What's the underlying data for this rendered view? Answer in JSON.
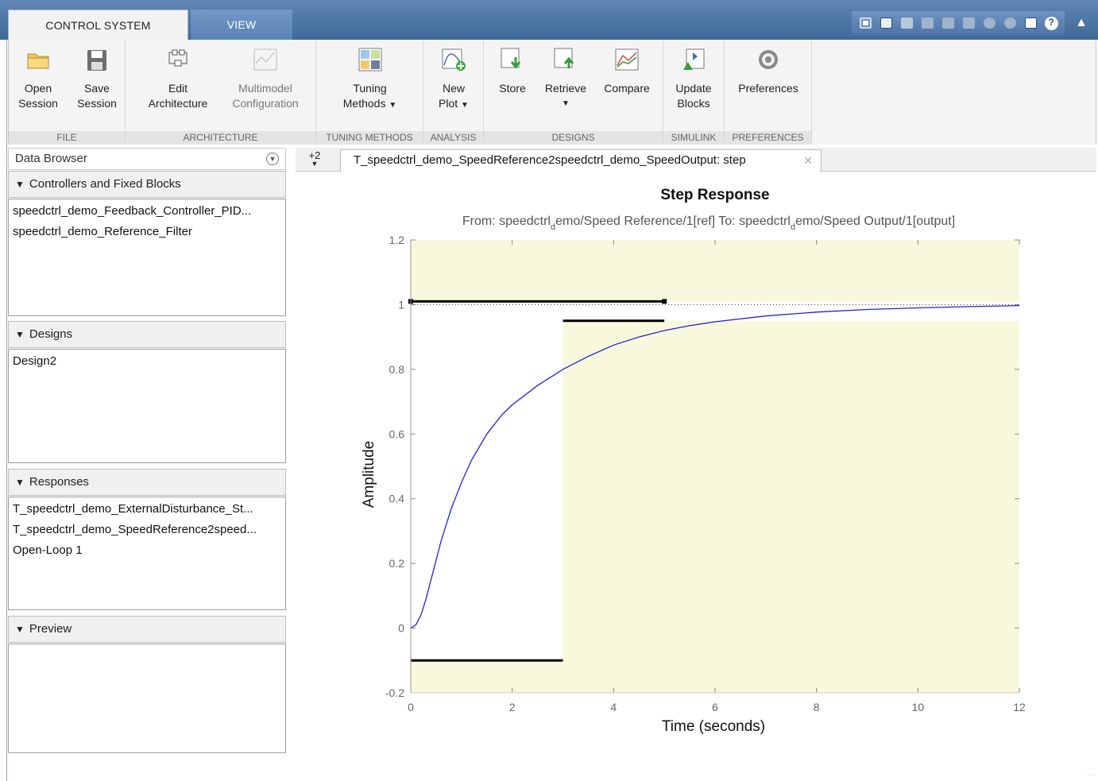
{
  "tabs": {
    "control_system": "CONTROL SYSTEM",
    "view": "VIEW"
  },
  "ribbon": {
    "file": {
      "label": "FILE",
      "open": [
        "Open",
        "Session"
      ],
      "save": [
        "Save",
        "Session"
      ]
    },
    "architecture": {
      "label": "ARCHITECTURE",
      "edit": [
        "Edit",
        "Architecture"
      ],
      "multimodel": [
        "Multimodel",
        "Configuration"
      ]
    },
    "tuning": {
      "label": "TUNING METHODS",
      "tuning_methods": [
        "Tuning",
        "Methods"
      ]
    },
    "analysis": {
      "label": "ANALYSIS",
      "new_plot": [
        "New",
        "Plot"
      ]
    },
    "designs": {
      "label": "DESIGNS",
      "store": "Store",
      "retrieve": "Retrieve",
      "compare": "Compare"
    },
    "simulink": {
      "label": "SIMULINK",
      "update": [
        "Update",
        "Blocks"
      ]
    },
    "preferences": {
      "label": "PREFERENCES",
      "preferences": "Preferences"
    }
  },
  "browser": {
    "title": "Data Browser",
    "controllers": {
      "title": "Controllers and Fixed Blocks",
      "items": [
        "speedctrl_demo_Feedback_Controller_PID...",
        "speedctrl_demo_Reference_Filter"
      ]
    },
    "designs": {
      "title": "Designs",
      "items": [
        "Design2"
      ]
    },
    "responses": {
      "title": "Responses",
      "items": [
        "T_speedctrl_demo_ExternalDisturbance_St...",
        "T_speedctrl_demo_SpeedReference2speed...",
        "Open-Loop 1"
      ]
    },
    "preview": {
      "title": "Preview"
    }
  },
  "doc_tabs": {
    "more": "+2",
    "active": "T_speedctrl_demo_SpeedReference2speedctrl_demo_SpeedOutput: step",
    "close": "✕"
  },
  "colors": {
    "accent": "#3f6897",
    "curve": "#2222dd",
    "region": "#f8f8dc"
  },
  "chart_data": {
    "type": "line",
    "title": "Step Response",
    "subtitle_from": "From: speedctrl",
    "subtitle_sub1": "d",
    "subtitle_mid": "emo/Speed Reference/1[ref]  To: speedctrl",
    "subtitle_sub2": "d",
    "subtitle_end": "emo/Speed Output/1[output]",
    "xlabel": "Time (seconds)",
    "ylabel": "Amplitude",
    "xlim": [
      0,
      12
    ],
    "ylim": [
      -0.2,
      1.2
    ],
    "xticks": [
      0,
      2,
      4,
      6,
      8,
      10,
      12
    ],
    "yticks": [
      -0.2,
      0,
      0.2,
      0.4,
      0.6,
      0.8,
      1,
      1.2
    ],
    "series": [
      {
        "values_note": "",
        "x": [
          0,
          0.1,
          0.2,
          0.3,
          0.4,
          0.5,
          0.6,
          0.8,
          1,
          1.2,
          1.5,
          1.8,
          2,
          2.5,
          3,
          3.5,
          4,
          4.5,
          5,
          5.5,
          6,
          7,
          8,
          9,
          10,
          11,
          12
        ],
        "y": [
          0,
          0.01,
          0.04,
          0.09,
          0.15,
          0.21,
          0.27,
          0.37,
          0.45,
          0.52,
          0.6,
          0.66,
          0.69,
          0.75,
          0.8,
          0.84,
          0.875,
          0.9,
          0.92,
          0.935,
          0.947,
          0.965,
          0.977,
          0.985,
          0.99,
          0.994,
          0.997
        ]
      }
    ],
    "reference_line": 1,
    "constraints": {
      "overshoot": {
        "x": [
          0,
          5
        ],
        "y": 1.01
      },
      "settling_upper": {
        "x": [
          3,
          5
        ],
        "y": 0.95
      },
      "undershoot": {
        "x": [
          0,
          3
        ],
        "y": -0.1
      }
    }
  }
}
